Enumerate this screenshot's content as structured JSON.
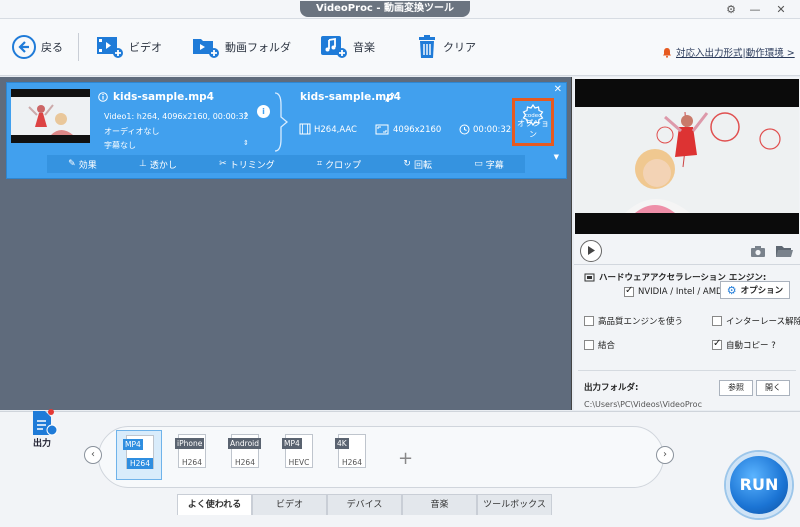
{
  "window": {
    "title": "VideoProc - 動画変換ツール"
  },
  "toolbar": {
    "back": "戻る",
    "video": "ビデオ",
    "video_folder": "動画フォルダ",
    "music": "音楽",
    "clear": "クリア",
    "notice": "対応入出力形式|動作環境 >"
  },
  "file": {
    "source_name": "kids-sample.mp4",
    "video_info": "Video1: h264, 4096x2160, 00:00:32",
    "audio": "オーディオなし",
    "subtitle": "字幕なし",
    "output_name": "kids-sample.mp4",
    "codec": "H264,AAC",
    "resolution": "4096x2160",
    "duration": "00:00:32",
    "codec_option_label": "オプション",
    "codec_badge": "codec"
  },
  "edit_bar": [
    {
      "label": "効果"
    },
    {
      "label": "透かし"
    },
    {
      "label": "トリミング"
    },
    {
      "label": "クロップ"
    },
    {
      "label": "回転"
    },
    {
      "label": "字幕"
    }
  ],
  "settings": {
    "hw_title": "ハードウェアアクセラレーション エンジン:",
    "hw_vendor": "NVIDIA / Intel / AMD",
    "option_btn": "オプション",
    "hq_engine": "高品質エンジンを使う",
    "deinterlace": "インターレース解除",
    "merge": "結合",
    "auto_copy": "自動コピー ?",
    "output_folder_label": "出力フォルダ:",
    "browse": "参照",
    "open": "開く",
    "output_path": "C:\\Users\\PC\\Videos\\VideoProc"
  },
  "bottom": {
    "output_label": "出力",
    "formats": [
      {
        "top": "MP4",
        "bottom": "H264",
        "selected": true
      },
      {
        "top": "iPhone",
        "bottom": "H264",
        "selected": false
      },
      {
        "top": "Android",
        "bottom": "H264",
        "selected": false
      },
      {
        "top": "MP4",
        "bottom": "HEVC",
        "selected": false
      },
      {
        "top": "4K",
        "bottom": "H264",
        "selected": false
      }
    ],
    "tabs": [
      {
        "label": "よく使われる",
        "active": true
      },
      {
        "label": "ビデオ",
        "active": false
      },
      {
        "label": "デバイス",
        "active": false
      },
      {
        "label": "音楽",
        "active": false
      },
      {
        "label": "ツールボックス",
        "active": false
      }
    ],
    "run": "RUN"
  },
  "colors": {
    "accent": "#41a0ee",
    "highlight": "#e65a20",
    "run": "#1b74d4"
  }
}
